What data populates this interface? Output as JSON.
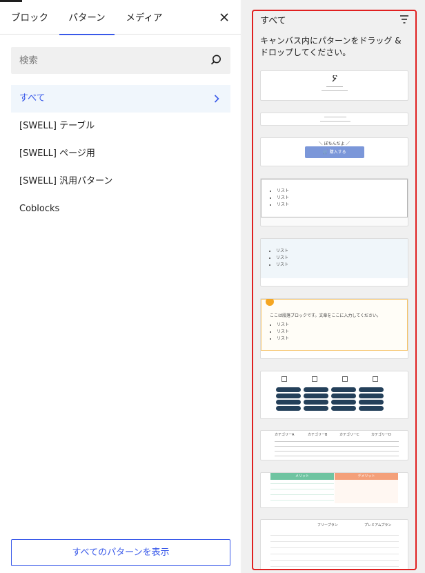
{
  "tabs": [
    {
      "label": "ブロック"
    },
    {
      "label": "パターン"
    },
    {
      "label": "メディア"
    }
  ],
  "search": {
    "placeholder": "検索",
    "value": ""
  },
  "categories": [
    {
      "label": "すべて"
    },
    {
      "label": "[SWELL] テーブル"
    },
    {
      "label": "[SWELL] ページ用"
    },
    {
      "label": "[SWELL] 汎用パターン"
    },
    {
      "label": "Coblocks"
    }
  ],
  "view_all_label": "すべてのパターンを表示",
  "right": {
    "title": "すべて",
    "hint": "キャンバス内にパターンをドラッグ & ドロップしてください。"
  },
  "previews": {
    "cta_top": "＼ ぽちんだよ ／",
    "cta_button": "🛒 購入する",
    "list_item": "リスト",
    "paragraph": "ここは段落ブロックです。文章をここに入力してください。",
    "merit": "メリット",
    "demerit": "デメリット",
    "plan_free": "フリープラン",
    "plan_premium": "プレミアムプラン",
    "cat_a": "カテゴリーA",
    "cat_b": "カテゴリーB",
    "cat_c": "カテゴリーC",
    "cat_d": "カテゴリーD"
  },
  "colors": {
    "accent": "#3858e9",
    "highlight": "#e02020"
  }
}
